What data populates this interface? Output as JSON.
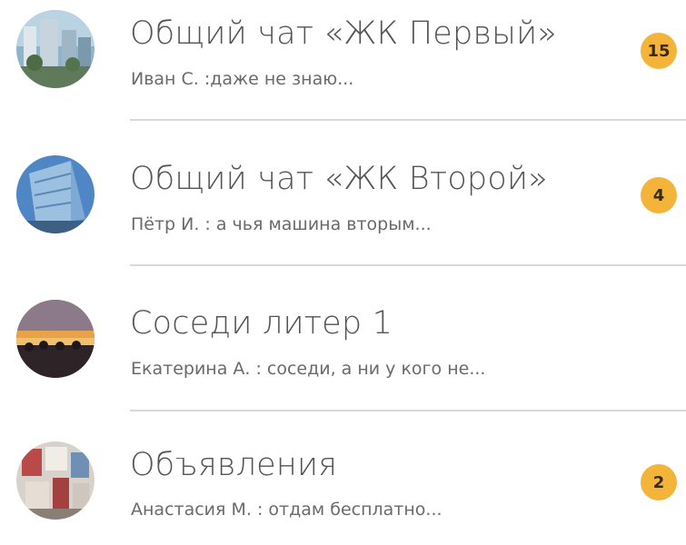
{
  "chats": [
    {
      "title": "Общий чат «ЖК Первый»",
      "preview": "Иван С. :даже не знаю...",
      "unread": "15"
    },
    {
      "title": "Общий чат «ЖК Второй»",
      "preview": "Пётр И. : а чья машина вторым...",
      "unread": "4"
    },
    {
      "title": "Соседи литер 1",
      "preview": "Екатерина А. : соседи, а ни у кого не...",
      "unread": ""
    },
    {
      "title": "Объявления",
      "preview": "Анастасия М. : отдам бесплатно...",
      "unread": "2"
    }
  ],
  "colors": {
    "badge": "#f4b43a",
    "divider": "#d9d9d9"
  }
}
